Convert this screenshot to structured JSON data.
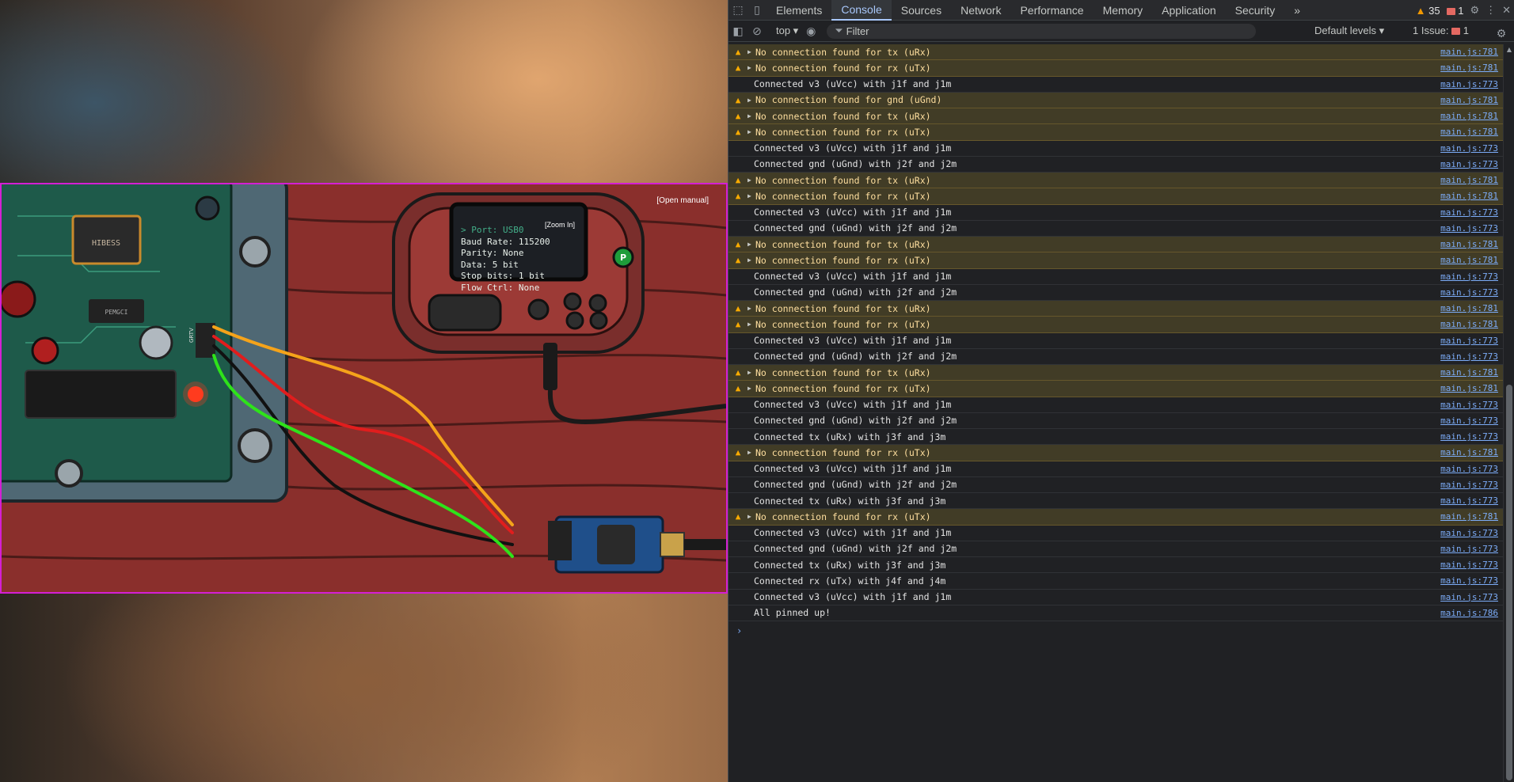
{
  "game": {
    "open_manual": "[Open manual]",
    "zoom_in": "[Zoom In]",
    "screen_lines": [
      "> Port: USB0",
      "Baud Rate: 115200",
      "Parity: None",
      "Data: 5 bit",
      "Stop bits: 1 bit",
      "Flow Ctrl: None"
    ],
    "pcb_chip_label": "HIBESS",
    "pcb_chip2_label": "PEMGCI",
    "header_label": "GRTV",
    "device_button_label": "P",
    "colors": {
      "frame": "#d41fd4",
      "wood": "#8a2f2c",
      "pcb": "#1e5a4a",
      "device": "#7a2e2c"
    },
    "wires": [
      "orange",
      "red",
      "black",
      "green"
    ]
  },
  "devtools": {
    "tabs": [
      "Elements",
      "Console",
      "Sources",
      "Network",
      "Performance",
      "Memory",
      "Application",
      "Security"
    ],
    "active_tab": "Console",
    "more_tabs": "»",
    "warning_count": "35",
    "error_count": "1",
    "toolbar": {
      "context": "top ▾",
      "filter_placeholder": "Filter",
      "levels": "Default levels ▾",
      "issues_label": "1 Issue:",
      "issues_count": "1"
    },
    "logs": [
      {
        "level": "warning",
        "text": "No connection found for tx (uRx)",
        "src": "main.js:781"
      },
      {
        "level": "warning",
        "text": "No connection found for rx (uTx)",
        "src": "main.js:781"
      },
      {
        "level": "info",
        "text": "Connected v3 (uVcc) with j1f and j1m",
        "src": "main.js:773"
      },
      {
        "level": "warning",
        "text": "No connection found for gnd (uGnd)",
        "src": "main.js:781"
      },
      {
        "level": "warning",
        "text": "No connection found for tx (uRx)",
        "src": "main.js:781"
      },
      {
        "level": "warning",
        "text": "No connection found for rx (uTx)",
        "src": "main.js:781"
      },
      {
        "level": "info",
        "text": "Connected v3 (uVcc) with j1f and j1m",
        "src": "main.js:773"
      },
      {
        "level": "info",
        "text": "Connected gnd (uGnd) with j2f and j2m",
        "src": "main.js:773"
      },
      {
        "level": "warning",
        "text": "No connection found for tx (uRx)",
        "src": "main.js:781"
      },
      {
        "level": "warning",
        "text": "No connection found for rx (uTx)",
        "src": "main.js:781"
      },
      {
        "level": "info",
        "text": "Connected v3 (uVcc) with j1f and j1m",
        "src": "main.js:773"
      },
      {
        "level": "info",
        "text": "Connected gnd (uGnd) with j2f and j2m",
        "src": "main.js:773"
      },
      {
        "level": "warning",
        "text": "No connection found for tx (uRx)",
        "src": "main.js:781"
      },
      {
        "level": "warning",
        "text": "No connection found for rx (uTx)",
        "src": "main.js:781"
      },
      {
        "level": "info",
        "text": "Connected v3 (uVcc) with j1f and j1m",
        "src": "main.js:773"
      },
      {
        "level": "info",
        "text": "Connected gnd (uGnd) with j2f and j2m",
        "src": "main.js:773"
      },
      {
        "level": "warning",
        "text": "No connection found for tx (uRx)",
        "src": "main.js:781"
      },
      {
        "level": "warning",
        "text": "No connection found for rx (uTx)",
        "src": "main.js:781"
      },
      {
        "level": "info",
        "text": "Connected v3 (uVcc) with j1f and j1m",
        "src": "main.js:773"
      },
      {
        "level": "info",
        "text": "Connected gnd (uGnd) with j2f and j2m",
        "src": "main.js:773"
      },
      {
        "level": "warning",
        "text": "No connection found for tx (uRx)",
        "src": "main.js:781"
      },
      {
        "level": "warning",
        "text": "No connection found for rx (uTx)",
        "src": "main.js:781"
      },
      {
        "level": "info",
        "text": "Connected v3 (uVcc) with j1f and j1m",
        "src": "main.js:773"
      },
      {
        "level": "info",
        "text": "Connected gnd (uGnd) with j2f and j2m",
        "src": "main.js:773"
      },
      {
        "level": "info",
        "text": "Connected tx (uRx) with j3f and j3m",
        "src": "main.js:773"
      },
      {
        "level": "warning",
        "text": "No connection found for rx (uTx)",
        "src": "main.js:781"
      },
      {
        "level": "info",
        "text": "Connected v3 (uVcc) with j1f and j1m",
        "src": "main.js:773"
      },
      {
        "level": "info",
        "text": "Connected gnd (uGnd) with j2f and j2m",
        "src": "main.js:773"
      },
      {
        "level": "info",
        "text": "Connected tx (uRx) with j3f and j3m",
        "src": "main.js:773"
      },
      {
        "level": "warning",
        "text": "No connection found for rx (uTx)",
        "src": "main.js:781"
      },
      {
        "level": "info",
        "text": "Connected v3 (uVcc) with j1f and j1m",
        "src": "main.js:773"
      },
      {
        "level": "info",
        "text": "Connected gnd (uGnd) with j2f and j2m",
        "src": "main.js:773"
      },
      {
        "level": "info",
        "text": "Connected tx (uRx) with j3f and j3m",
        "src": "main.js:773"
      },
      {
        "level": "info",
        "text": "Connected rx (uTx) with j4f and j4m",
        "src": "main.js:773"
      },
      {
        "level": "info",
        "text": "Connected v3 (uVcc) with j1f and j1m",
        "src": "main.js:773"
      },
      {
        "level": "info",
        "text": "All pinned up!",
        "src": "main.js:786"
      }
    ],
    "prompt_symbol": "›"
  }
}
